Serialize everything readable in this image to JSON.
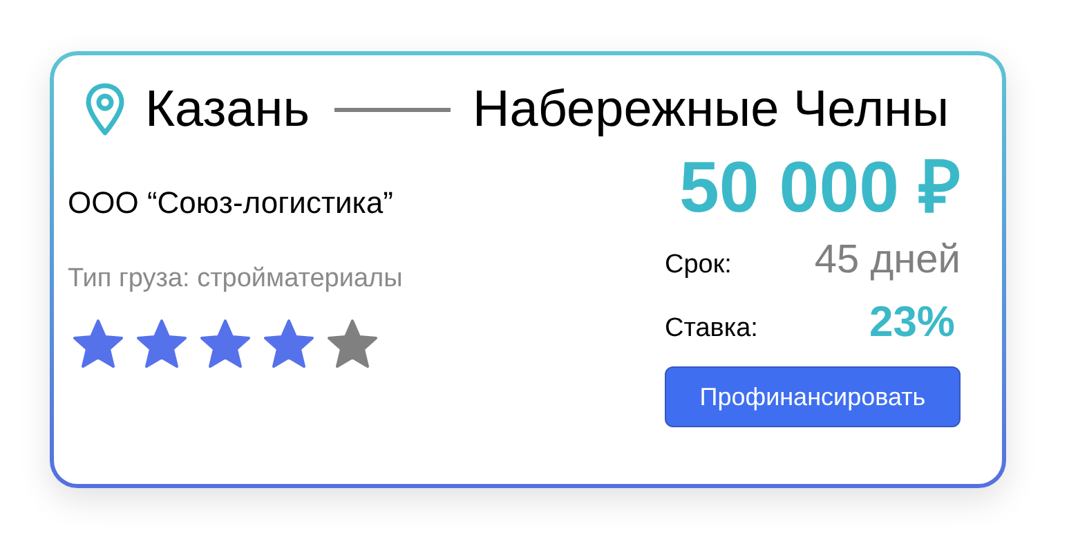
{
  "route": {
    "from": "Казань",
    "to": "Набережные Челны"
  },
  "company": "ООО “Союз-логистика”",
  "cargo_type": "Тип груза: стройматериалы",
  "rating": {
    "stars": 4
  },
  "price": "50 000 ₽",
  "term": {
    "label": "Срок:",
    "value": "45 дней"
  },
  "rate": {
    "label": "Ставка:",
    "value": "23%"
  },
  "button": "Профинансировать"
}
